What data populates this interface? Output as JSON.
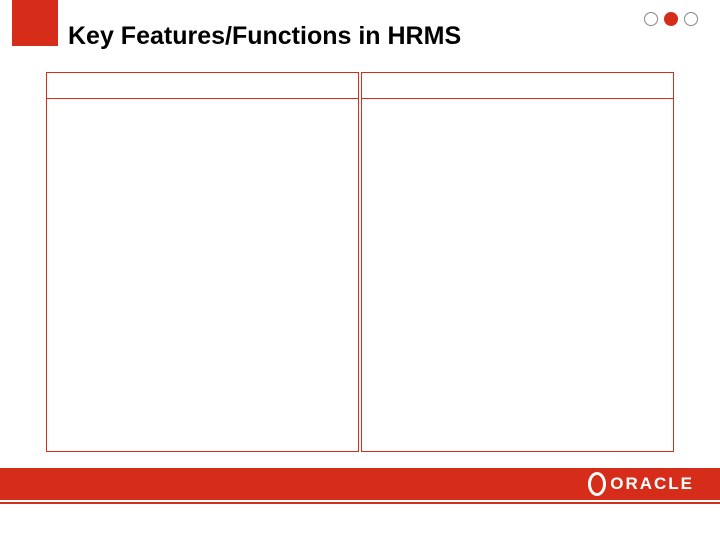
{
  "header": {
    "title": "Key Features/Functions in HRMS"
  },
  "panels": {
    "left": {
      "header": ""
    },
    "right": {
      "header": ""
    }
  },
  "footer": {
    "logo_text": "ORACLE"
  }
}
